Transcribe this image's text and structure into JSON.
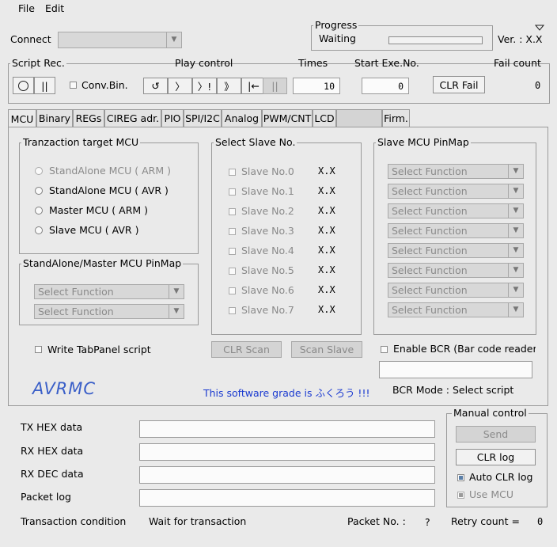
{
  "menu": {
    "file": "File",
    "edit": "Edit"
  },
  "connect": {
    "label": "Connect"
  },
  "progress": {
    "title": "Progress",
    "status": "Waiting",
    "value": 0
  },
  "version": {
    "label": "Ver. : X.X"
  },
  "script_rec": {
    "title": "Script Rec.",
    "conv_bin": "Conv.Bin."
  },
  "play_control": {
    "title": "Play control",
    "buttons": [
      "↺",
      "〉",
      "〉!",
      "》",
      "|←",
      "||"
    ]
  },
  "times": {
    "label": "Times",
    "value": "10"
  },
  "start_exe": {
    "label": "Start Exe.No.",
    "value": "0"
  },
  "clr_fail": {
    "label": "CLR Fail"
  },
  "fail_count": {
    "label": "Fail count",
    "value": "0"
  },
  "tabs": [
    "MCU",
    "Binary",
    "REGs",
    "CIREG adr.",
    "PIO",
    "SPI/I2C",
    "Analog",
    "PWM/CNT",
    "LCD",
    "",
    "Firm."
  ],
  "mcu": {
    "target_title": "Tranzaction target MCU",
    "targets": [
      "StandAlone MCU ( ARM )",
      "StandAlone MCU ( AVR )",
      "Master MCU ( ARM )",
      "Slave MCU ( AVR )"
    ],
    "pinmap_title": "StandAlone/Master MCU PinMap",
    "select_function": "Select Function",
    "slave_title": "Select Slave No.",
    "slaves": [
      {
        "label": "Slave No.0",
        "value": "X.X"
      },
      {
        "label": "Slave No.1",
        "value": "X.X"
      },
      {
        "label": "Slave No.2",
        "value": "X.X"
      },
      {
        "label": "Slave No.3",
        "value": "X.X"
      },
      {
        "label": "Slave No.4",
        "value": "X.X"
      },
      {
        "label": "Slave No.5",
        "value": "X.X"
      },
      {
        "label": "Slave No.6",
        "value": "X.X"
      },
      {
        "label": "Slave No.7",
        "value": "X.X"
      }
    ],
    "slave_pinmap_title": "Slave MCU PinMap",
    "write_tabpanel": "Write TabPanel script",
    "clr_scan": "CLR Scan",
    "scan_slave": "Scan Slave",
    "enable_bcr": "Enable BCR (Bar code reader",
    "logo": "AVRMC",
    "grade_text": "This software grade is ふくろう !!!",
    "bcr_mode": "BCR Mode : Select script"
  },
  "data_fields": {
    "tx_hex": "TX HEX data",
    "rx_hex": "RX HEX data",
    "rx_dec": "RX DEC data",
    "packet_log": "Packet log"
  },
  "manual": {
    "title": "Manual control",
    "send": "Send",
    "clr_log": "CLR log",
    "auto_clr": "Auto CLR log",
    "use_mcu": "Use MCU"
  },
  "status": {
    "transaction_label": "Transaction condition",
    "transaction_value": "Wait for transaction",
    "packet_no_label": "Packet No. :",
    "packet_no_value": "?",
    "retry_label": "Retry count  =",
    "retry_value": "0"
  },
  "colors": {
    "blue_text": "#1a3ad0",
    "logo": "#3a5fc8",
    "check_fill": "#5a7fa8"
  }
}
